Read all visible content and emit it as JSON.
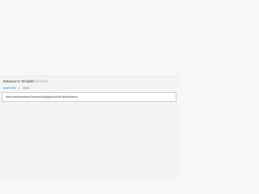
{
  "field": {
    "label": "Datasource Template",
    "qualifier": "[shared]",
    "value": "/sitecore/templates/Feature/Navigation/Ext/HeaderMenu"
  },
  "toolbar": {
    "insert_link": "Insert link",
    "clear": "Clear"
  },
  "colors": {
    "link": "#2a7fc0",
    "qualifier": "#a8a8a8",
    "input_border": "#cfcfcf"
  }
}
